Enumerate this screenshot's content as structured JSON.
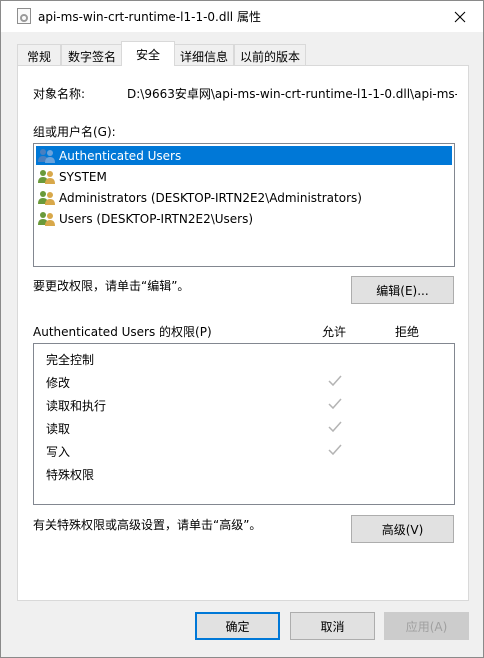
{
  "window": {
    "title": "api-ms-win-crt-runtime-l1-1-0.dll 属性",
    "close_glyph": "✕"
  },
  "tabs": [
    {
      "label": "常规",
      "active": false
    },
    {
      "label": "数字签名",
      "active": false
    },
    {
      "label": "安全",
      "active": true
    },
    {
      "label": "详细信息",
      "active": false
    },
    {
      "label": "以前的版本",
      "active": false
    }
  ],
  "security": {
    "object_name_label": "对象名称:",
    "object_name_value": "D:\\9663安卓网\\api-ms-win-crt-runtime-l1-1-0.dll\\api-ms-w",
    "group_label": "组或用户名(G):",
    "users": [
      {
        "name": "Authenticated Users",
        "selected": true,
        "icon": "users-group-icon"
      },
      {
        "name": "SYSTEM",
        "selected": false,
        "icon": "users-group-icon"
      },
      {
        "name": "Administrators (DESKTOP-IRTN2E2\\Administrators)",
        "selected": false,
        "icon": "users-group-icon"
      },
      {
        "name": "Users (DESKTOP-IRTN2E2\\Users)",
        "selected": false,
        "icon": "users-group-icon"
      }
    ],
    "change_hint": "要更改权限，请单击“编辑”。",
    "edit_button": "编辑(E)...",
    "permissions_label": "Authenticated Users 的权限(P)",
    "allow_header": "允许",
    "deny_header": "拒绝",
    "permissions": [
      {
        "name": "完全控制",
        "allow": false,
        "deny": false
      },
      {
        "name": "修改",
        "allow": true,
        "deny": false
      },
      {
        "name": "读取和执行",
        "allow": true,
        "deny": false
      },
      {
        "name": "读取",
        "allow": true,
        "deny": false
      },
      {
        "name": "写入",
        "allow": true,
        "deny": false
      },
      {
        "name": "特殊权限",
        "allow": false,
        "deny": false
      }
    ],
    "advanced_hint": "有关特殊权限或高级设置，请单击“高级”。",
    "advanced_button": "高级(V)"
  },
  "footer": {
    "ok": "确定",
    "cancel": "取消",
    "apply": "应用(A)"
  },
  "colors": {
    "selection": "#0078d7",
    "check_gray": "#b4b4b4"
  }
}
